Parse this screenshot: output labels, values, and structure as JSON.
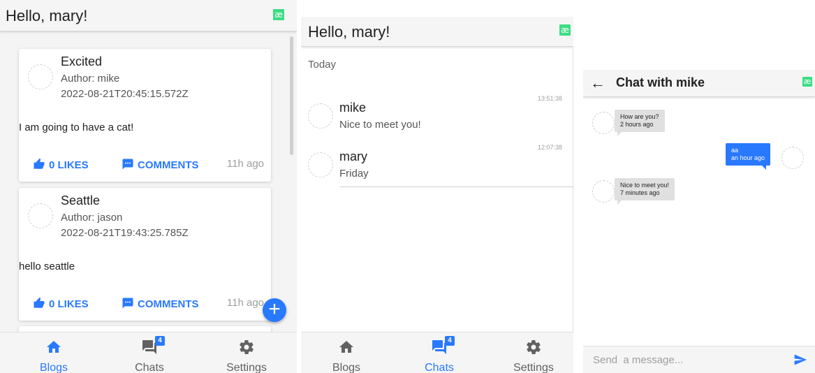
{
  "colors": {
    "accent": "#2979ff",
    "brand": "#3ddc84"
  },
  "brand_glyph": "æ",
  "blogs_screen": {
    "greeting": "Hello, mary!",
    "posts": [
      {
        "title": "Excited",
        "author": "Author: mike",
        "date": "2022-08-21T20:45:15.572Z",
        "body": "I am going to have a cat!",
        "likes": "0 LIKES",
        "comments": "COMMENTS",
        "ago": "11h ago"
      },
      {
        "title": "Seattle",
        "author": "Author: jason",
        "date": "2022-08-21T19:43:25.785Z",
        "body": "hello seattle",
        "likes": "0 LIKES",
        "comments": "COMMENTS",
        "ago": "11h ago"
      }
    ],
    "fab_icon": "plus-icon"
  },
  "chats_screen": {
    "greeting": "Hello, mary!",
    "section": "Today",
    "chats": [
      {
        "name": "mike",
        "last_message": "Nice to meet you!",
        "time": "13:51:38"
      },
      {
        "name": "mary",
        "last_message": "Friday",
        "time": "12:07:38"
      }
    ]
  },
  "chat_detail": {
    "title": "Chat with mike",
    "messages": [
      {
        "direction": "in",
        "text": "How are you?",
        "time": "2 hours ago"
      },
      {
        "direction": "out",
        "text": "aa",
        "time": "an hour ago"
      },
      {
        "direction": "in",
        "text": "Nice to meet you!",
        "time": "7 minutes ago"
      }
    ],
    "input_placeholder": "Send  a message..."
  },
  "tabs": [
    {
      "label": "Blogs",
      "icon": "home-icon"
    },
    {
      "label": "Chats",
      "icon": "chat-icon",
      "badge": "4"
    },
    {
      "label": "Settings",
      "icon": "gear-icon"
    }
  ]
}
